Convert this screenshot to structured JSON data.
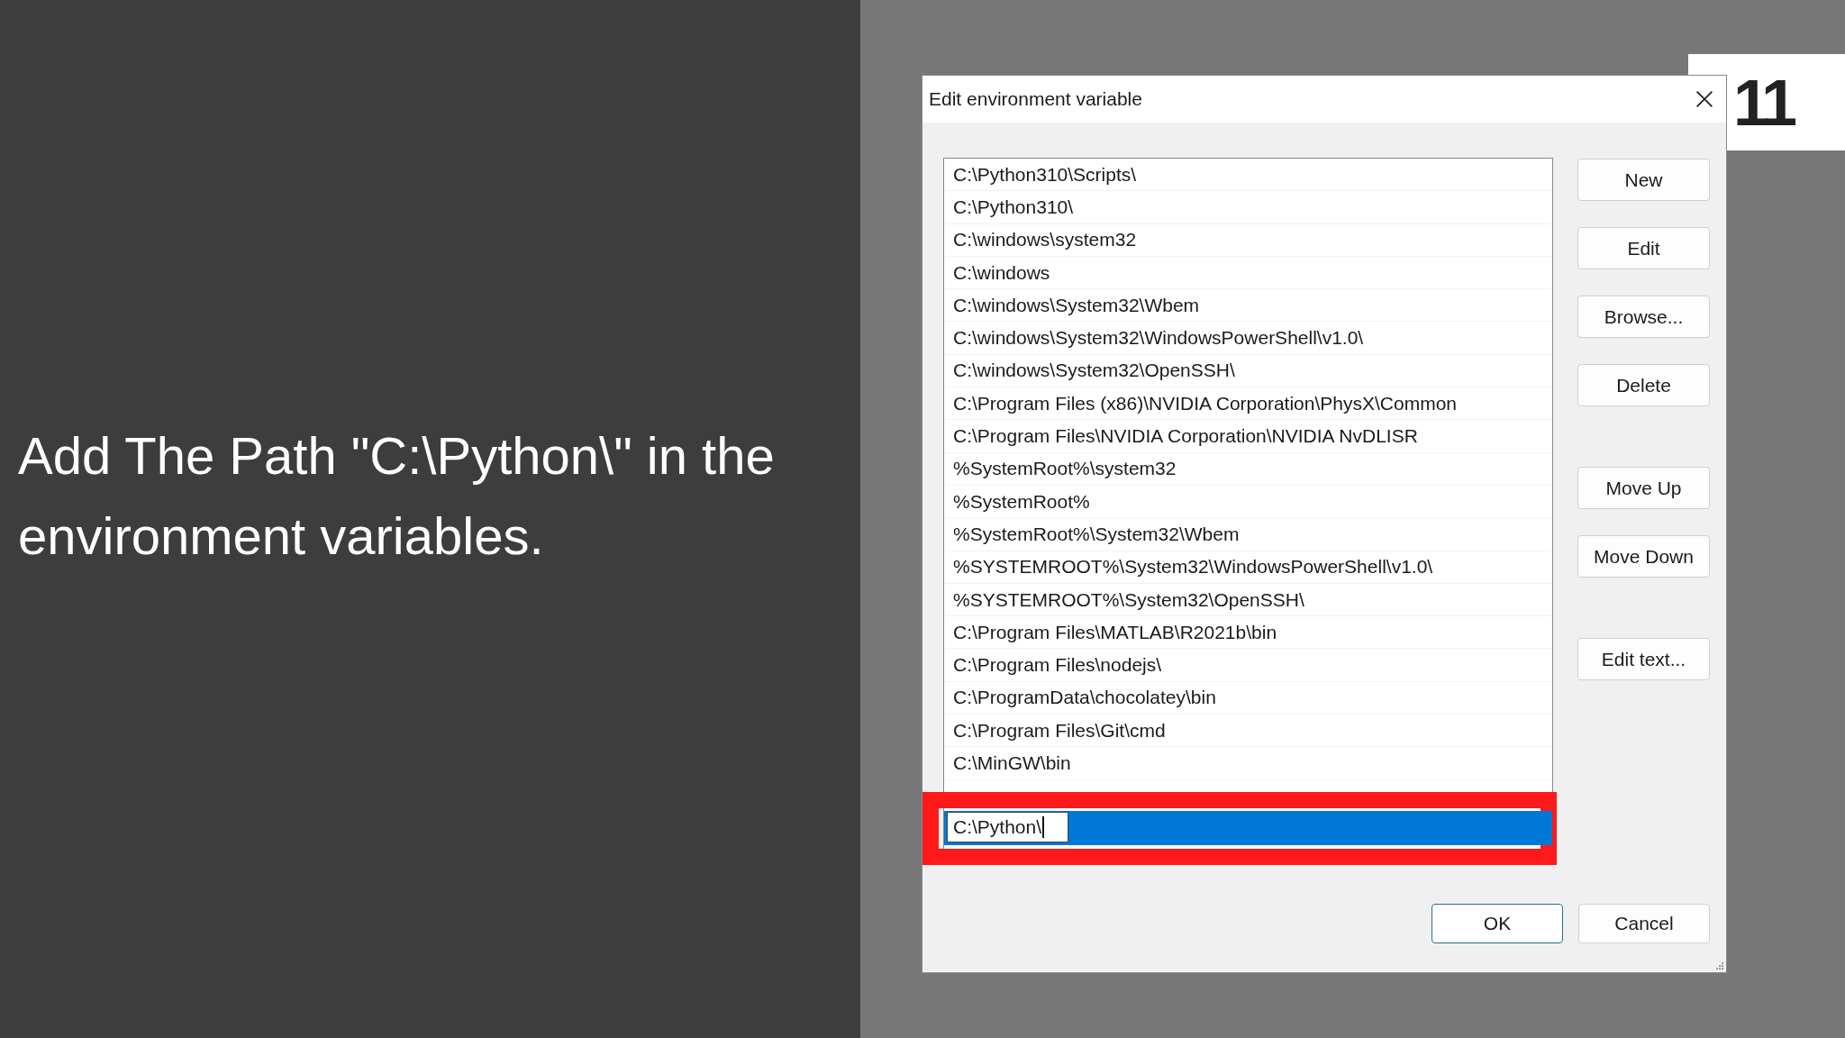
{
  "slide": {
    "caption": "Add The Path \"C:\\Python\\\" in the environment variables.",
    "step": "11"
  },
  "dialog": {
    "title": "Edit environment variable",
    "paths": [
      {
        "text": "C:\\Python310\\Scripts\\",
        "selected": false,
        "editing": false,
        "highlighted": false
      },
      {
        "text": "C:\\Python310\\",
        "selected": false,
        "editing": false,
        "highlighted": false
      },
      {
        "text": "C:\\windows\\system32",
        "selected": false,
        "editing": false,
        "highlighted": false
      },
      {
        "text": "C:\\windows",
        "selected": false,
        "editing": false,
        "highlighted": false
      },
      {
        "text": "C:\\windows\\System32\\Wbem",
        "selected": false,
        "editing": false,
        "highlighted": false
      },
      {
        "text": "C:\\windows\\System32\\WindowsPowerShell\\v1.0\\",
        "selected": false,
        "editing": false,
        "highlighted": false
      },
      {
        "text": "C:\\windows\\System32\\OpenSSH\\",
        "selected": false,
        "editing": false,
        "highlighted": false
      },
      {
        "text": "C:\\Program Files (x86)\\NVIDIA Corporation\\PhysX\\Common",
        "selected": false,
        "editing": false,
        "highlighted": false
      },
      {
        "text": "C:\\Program Files\\NVIDIA Corporation\\NVIDIA NvDLISR",
        "selected": false,
        "editing": false,
        "highlighted": false
      },
      {
        "text": "%SystemRoot%\\system32",
        "selected": false,
        "editing": false,
        "highlighted": false
      },
      {
        "text": "%SystemRoot%",
        "selected": false,
        "editing": false,
        "highlighted": false
      },
      {
        "text": "%SystemRoot%\\System32\\Wbem",
        "selected": false,
        "editing": false,
        "highlighted": false
      },
      {
        "text": "%SYSTEMROOT%\\System32\\WindowsPowerShell\\v1.0\\",
        "selected": false,
        "editing": false,
        "highlighted": false
      },
      {
        "text": "%SYSTEMROOT%\\System32\\OpenSSH\\",
        "selected": false,
        "editing": false,
        "highlighted": false
      },
      {
        "text": "C:\\Program Files\\MATLAB\\R2021b\\bin",
        "selected": false,
        "editing": false,
        "highlighted": false
      },
      {
        "text": "C:\\Program Files\\nodejs\\",
        "selected": false,
        "editing": false,
        "highlighted": false
      },
      {
        "text": "C:\\ProgramData\\chocolatey\\bin",
        "selected": false,
        "editing": false,
        "highlighted": false
      },
      {
        "text": "C:\\Program Files\\Git\\cmd",
        "selected": false,
        "editing": false,
        "highlighted": false
      },
      {
        "text": "C:\\MinGW\\bin",
        "selected": false,
        "editing": false,
        "highlighted": false
      },
      {
        "text": "C:\\Python\\",
        "selected": true,
        "editing": true,
        "highlighted": true
      }
    ],
    "side_button_groups": [
      [
        "New",
        "Edit",
        "Browse...",
        "Delete"
      ],
      [
        "Move Up",
        "Move Down"
      ],
      [
        "Edit text..."
      ]
    ],
    "footer_buttons": [
      {
        "label": "OK",
        "default": true
      },
      {
        "label": "Cancel",
        "default": false
      }
    ]
  }
}
